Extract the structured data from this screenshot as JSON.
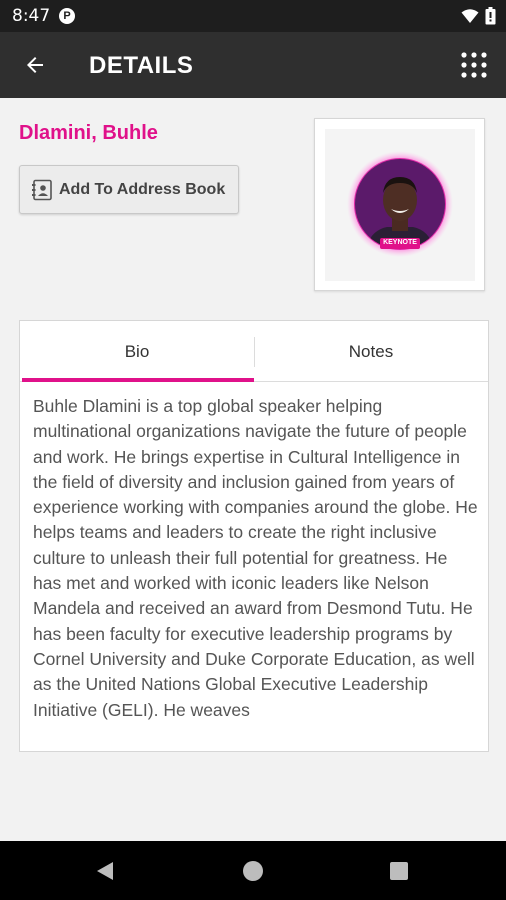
{
  "status_bar": {
    "time": "8:47",
    "app_icon_letter": "P",
    "icons": [
      "wifi-icon",
      "battery-icon"
    ]
  },
  "app_bar": {
    "title": "DETAILS",
    "back_icon": "arrow-left-icon",
    "menu_icon": "grid-icon"
  },
  "speaker": {
    "name": "Dlamini, Buhle",
    "photo_badge": "KEYNOTE",
    "name_color": "#e0118a"
  },
  "actions": {
    "add_to_address_book": "Add To Address Book",
    "add_icon": "contact-card-icon"
  },
  "tabs": [
    {
      "label": "Bio",
      "active": true
    },
    {
      "label": "Notes",
      "active": false
    }
  ],
  "bio": "Buhle Dlamini is a top global speaker helping multinational organizations navigate the future of people and work. He brings expertise in Cultural Intelligence in the field of diversity and inclusion gained from years of experience working with companies around the globe. He helps teams and leaders to create the right inclusive culture to unleash their full potential for greatness. He has met and worked with iconic leaders like Nelson Mandela and received an award from Desmond Tutu. He has been faculty for executive leadership programs by Cornel University and Duke Corporate Education, as well as the United Nations Global Executive Leadership Initiative (GELI). He weaves",
  "colors": {
    "accent": "#e0118a",
    "app_bar": "#2f2f2f",
    "status_bar": "#1e1e1e"
  },
  "nav": [
    "back-triangle-icon",
    "home-circle-icon",
    "recents-square-icon"
  ]
}
